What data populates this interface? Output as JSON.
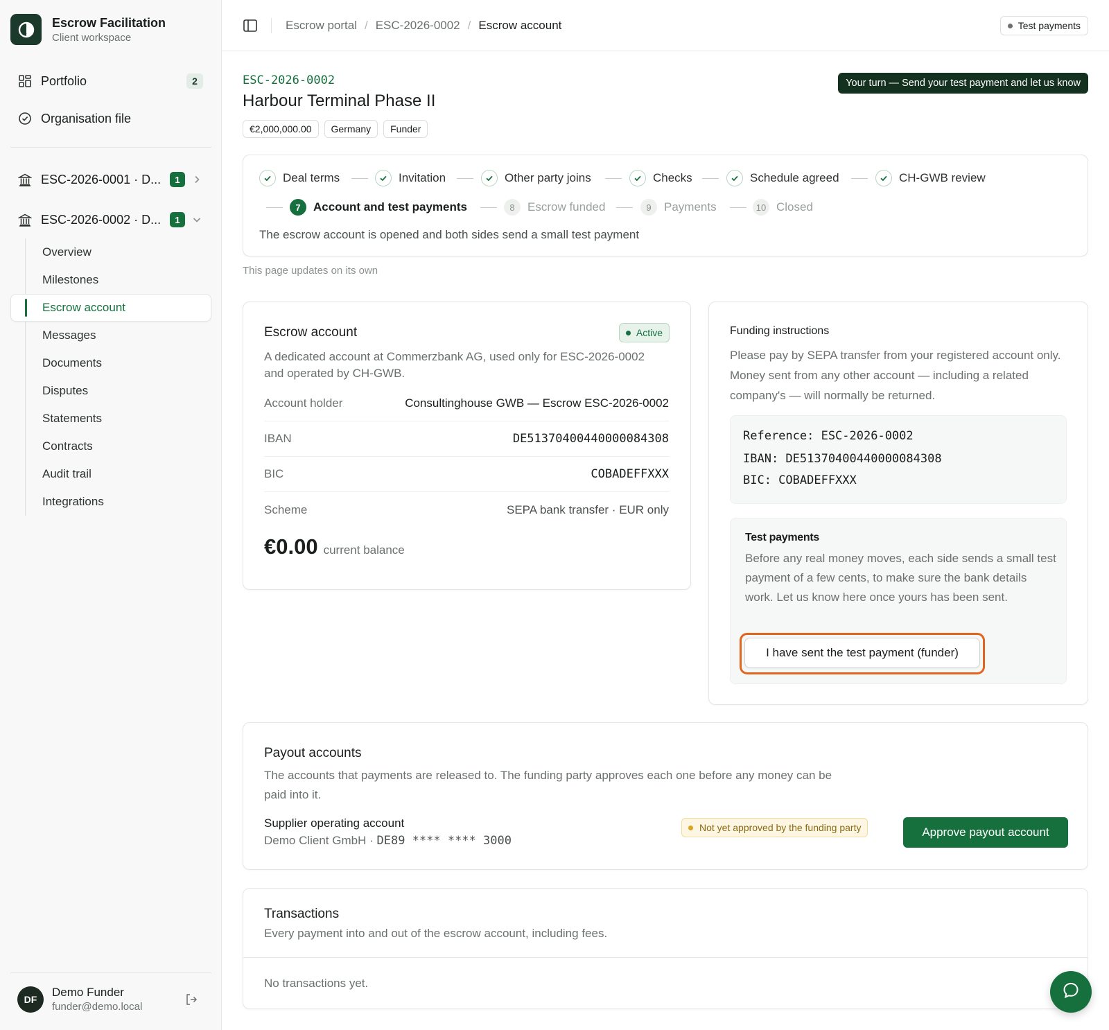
{
  "brand": {
    "title": "Escrow Facilitation",
    "subtitle": "Client workspace"
  },
  "sidebar": {
    "portfolio": {
      "label": "Portfolio",
      "count": "2"
    },
    "organisation": {
      "label": "Organisation file"
    },
    "cases": [
      {
        "label": "ESC-2026-0001 · D...",
        "badge": "1"
      },
      {
        "label": "ESC-2026-0002 · D...",
        "badge": "1"
      }
    ],
    "subnav": [
      "Overview",
      "Milestones",
      "Escrow account",
      "Messages",
      "Documents",
      "Disputes",
      "Statements",
      "Contracts",
      "Audit trail",
      "Integrations"
    ],
    "active_sub": "Escrow account"
  },
  "user": {
    "initials": "DF",
    "name": "Demo Funder",
    "email": "funder@demo.local"
  },
  "topbar": {
    "breadcrumbs": [
      "Escrow portal",
      "ESC-2026-0002",
      "Escrow account"
    ],
    "mode_label": "Test payments"
  },
  "case": {
    "code": "ESC-2026-0002",
    "title": "Harbour Terminal Phase II",
    "tags": [
      "€2,000,000.00",
      "Germany",
      "Funder"
    ],
    "turn_banner": "Your turn — Send your test payment and let us know"
  },
  "steps": {
    "items": [
      {
        "label": "Deal terms",
        "state": "done"
      },
      {
        "label": "Invitation",
        "state": "done"
      },
      {
        "label": "Other party joins",
        "state": "done"
      },
      {
        "label": "Checks",
        "state": "done"
      },
      {
        "label": "Schedule agreed",
        "state": "done"
      },
      {
        "label": "CH-GWB review",
        "state": "done"
      },
      {
        "num": "7",
        "label": "Account and test payments",
        "state": "active"
      },
      {
        "num": "8",
        "label": "Escrow funded",
        "state": "todo"
      },
      {
        "num": "9",
        "label": "Payments",
        "state": "todo"
      },
      {
        "num": "10",
        "label": "Closed",
        "state": "todo"
      }
    ],
    "description": "The escrow account is opened and both sides send a small test payment"
  },
  "live_note": "This page updates on its own",
  "escrow_account": {
    "title": "Escrow account",
    "status": "Active",
    "description": "A dedicated account at Commerzbank AG, used only for ESC-2026-0002 and operated by CH-GWB.",
    "rows": [
      {
        "key": "Account holder",
        "value": "Consultinghouse GWB — Escrow ESC-2026-0002"
      },
      {
        "key": "IBAN",
        "value": "DE51370400440000084308"
      },
      {
        "key": "BIC",
        "value": "COBADEFFXXX"
      },
      {
        "key": "Scheme",
        "value": "SEPA bank transfer · EUR only"
      }
    ],
    "balance": "€0.00",
    "balance_label": "current balance"
  },
  "funding": {
    "title": "Funding instructions",
    "text": "Please pay by SEPA transfer from your registered account only. Money sent from any other account — including a related company's — will normally be returned.",
    "reference_line": "Reference: ESC-2026-0002",
    "iban_line": "IBAN: DE51370400440000084308",
    "bic_line": "BIC: COBADEFFXXX",
    "test_title": "Test payments",
    "test_text": "Before any real money moves, each side sends a small test payment of a few cents, to make sure the bank details work. Let us know here once yours has been sent.",
    "test_button": "I have sent the test payment (funder)"
  },
  "payout": {
    "title": "Payout accounts",
    "text": "The accounts that payments are released to. The funding party approves each one before any money can be paid into it.",
    "account_name": "Supplier operating account",
    "account_detail_prefix": "Demo Client GmbH · ",
    "account_iban": "DE89 **** **** 3000",
    "status": "Not yet approved by the funding party",
    "approve_button": "Approve payout account"
  },
  "transactions": {
    "title": "Transactions",
    "text": "Every payment into and out of the escrow account, including fees.",
    "empty": "No transactions yet."
  },
  "colors": {
    "accent": "#15703d",
    "dark": "#14301f",
    "focus": "#e0651f",
    "warning": "#d9a521"
  },
  "icons": [
    "logo-icon",
    "portfolio-grid-icon",
    "check-circle-icon",
    "bank-icon",
    "chevron-right-icon",
    "chevron-down-icon",
    "sidebar-toggle-icon",
    "logout-icon",
    "chat-icon",
    "check-icon"
  ]
}
